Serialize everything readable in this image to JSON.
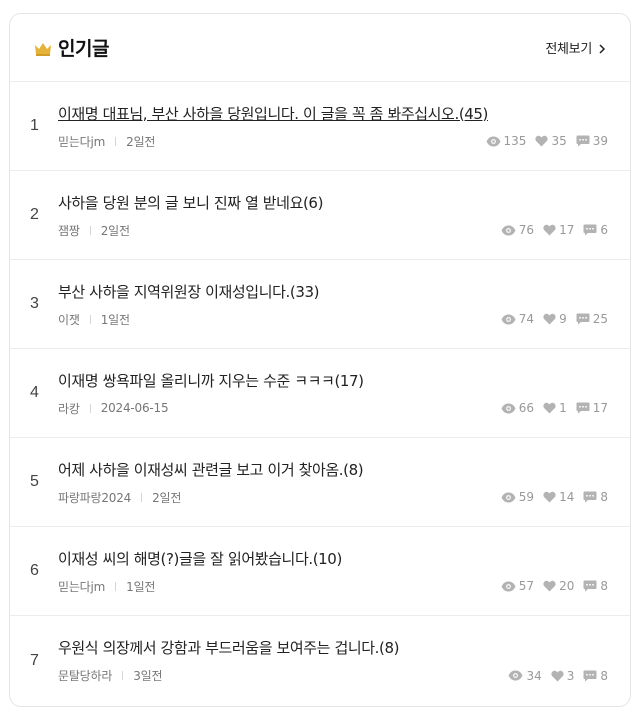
{
  "header": {
    "title": "인기글",
    "view_all_label": "전체보기"
  },
  "posts": [
    {
      "rank": "1",
      "title": "이재명 대표님, 부산 사하을 당원입니다. 이 글을 꼭 좀 봐주십시오.(45)",
      "author": "믿는다jm",
      "time": "2일전",
      "views": "135",
      "likes": "35",
      "comments": "39"
    },
    {
      "rank": "2",
      "title": "사하을 당원 분의 글 보니 진짜 열 받네요(6)",
      "author": "잼짱",
      "time": "2일전",
      "views": "76",
      "likes": "17",
      "comments": "6"
    },
    {
      "rank": "3",
      "title": "부산 사하을 지역위원장 이재성입니다.(33)",
      "author": "이잿",
      "time": "1일전",
      "views": "74",
      "likes": "9",
      "comments": "25"
    },
    {
      "rank": "4",
      "title": "이재명 쌍욕파일 올리니까 지우는 수준 ㅋㅋㅋ(17)",
      "author": "라캉",
      "time": "2024-06-15",
      "views": "66",
      "likes": "1",
      "comments": "17"
    },
    {
      "rank": "5",
      "title": "어제 사하을 이재성씨 관련글 보고 이거 찾아옴.(8)",
      "author": "파랑파랑2024",
      "time": "2일전",
      "views": "59",
      "likes": "14",
      "comments": "8"
    },
    {
      "rank": "6",
      "title": "이재성 씨의 해명(?)글을 잘 읽어봤습니다.(10)",
      "author": "믿는다jm",
      "time": "1일전",
      "views": "57",
      "likes": "20",
      "comments": "8"
    },
    {
      "rank": "7",
      "title": "우원식 의장께서 강함과 부드러움을 보여주는 겁니다.(8)",
      "author": "문탈당하라",
      "time": "3일전",
      "views": "34",
      "likes": "3",
      "comments": "8"
    }
  ],
  "colors": {
    "crown": "#e5b33a",
    "icon_gray": "#b3b3b3"
  }
}
